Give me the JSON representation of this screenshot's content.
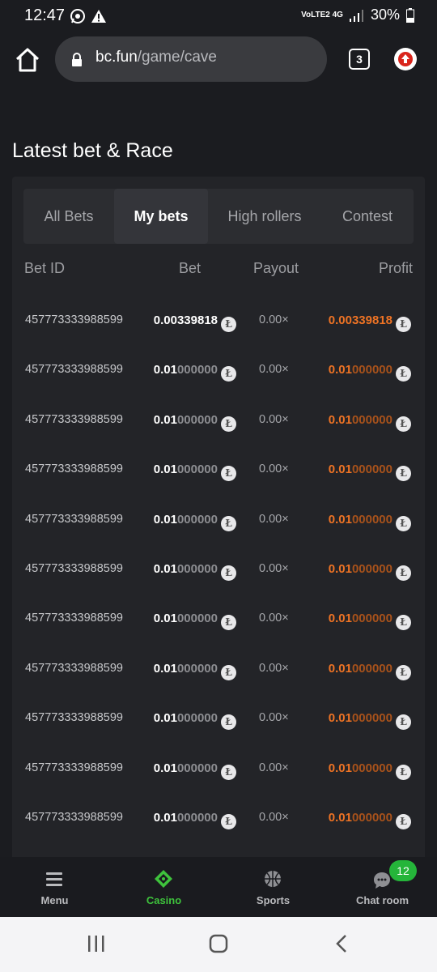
{
  "status_bar": {
    "time": "12:47",
    "left_icons": [
      "whatsapp-icon",
      "warning-icon"
    ],
    "network": "VoLTE2 4G",
    "battery": "30%"
  },
  "browser": {
    "url_domain": "bc.fun",
    "url_path": "/game/cave",
    "tab_count": "3"
  },
  "section": {
    "title": "Latest bet & Race"
  },
  "tabs": [
    {
      "label": "All Bets",
      "active": false
    },
    {
      "label": "My bets",
      "active": true
    },
    {
      "label": "High rollers",
      "active": false
    },
    {
      "label": "Contest",
      "active": false
    }
  ],
  "table": {
    "headers": {
      "bet_id": "Bet ID",
      "bet": "Bet",
      "payout": "Payout",
      "profit": "Profit"
    },
    "rows": [
      {
        "id": "457773333988599",
        "bet_hi": "0.00339818",
        "bet_lo": "",
        "payout": "0.00×",
        "profit_hi": "0.00339818",
        "profit_lo": ""
      },
      {
        "id": "457773333988599",
        "bet_hi": "0.01",
        "bet_lo": "000000",
        "payout": "0.00×",
        "profit_hi": "0.01",
        "profit_lo": "000000"
      },
      {
        "id": "457773333988599",
        "bet_hi": "0.01",
        "bet_lo": "000000",
        "payout": "0.00×",
        "profit_hi": "0.01",
        "profit_lo": "000000"
      },
      {
        "id": "457773333988599",
        "bet_hi": "0.01",
        "bet_lo": "000000",
        "payout": "0.00×",
        "profit_hi": "0.01",
        "profit_lo": "000000"
      },
      {
        "id": "457773333988599",
        "bet_hi": "0.01",
        "bet_lo": "000000",
        "payout": "0.00×",
        "profit_hi": "0.01",
        "profit_lo": "000000"
      },
      {
        "id": "457773333988599",
        "bet_hi": "0.01",
        "bet_lo": "000000",
        "payout": "0.00×",
        "profit_hi": "0.01",
        "profit_lo": "000000"
      },
      {
        "id": "457773333988599",
        "bet_hi": "0.01",
        "bet_lo": "000000",
        "payout": "0.00×",
        "profit_hi": "0.01",
        "profit_lo": "000000"
      },
      {
        "id": "457773333988599",
        "bet_hi": "0.01",
        "bet_lo": "000000",
        "payout": "0.00×",
        "profit_hi": "0.01",
        "profit_lo": "000000"
      },
      {
        "id": "457773333988599",
        "bet_hi": "0.01",
        "bet_lo": "000000",
        "payout": "0.00×",
        "profit_hi": "0.01",
        "profit_lo": "000000"
      },
      {
        "id": "457773333988599",
        "bet_hi": "0.01",
        "bet_lo": "000000",
        "payout": "0.00×",
        "profit_hi": "0.01",
        "profit_lo": "000000"
      },
      {
        "id": "457773333988599",
        "bet_hi": "0.01",
        "bet_lo": "000000",
        "payout": "0.00×",
        "profit_hi": "0.01",
        "profit_lo": "000000"
      }
    ],
    "currency_icon": "litecoin-icon"
  },
  "bottom_nav": [
    {
      "label": "Menu",
      "icon": "menu-icon",
      "active": false
    },
    {
      "label": "Casino",
      "icon": "casino-icon",
      "active": true
    },
    {
      "label": "Sports",
      "icon": "sports-icon",
      "active": false
    },
    {
      "label": "Chat room",
      "icon": "chat-icon",
      "active": false,
      "badge": "12"
    }
  ],
  "colors": {
    "background": "#1b1c20",
    "card": "#232428",
    "accent_green": "#3ec23c",
    "profit_orange": "#ee7324"
  }
}
